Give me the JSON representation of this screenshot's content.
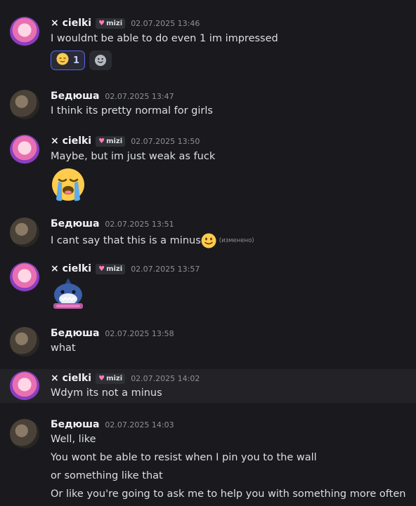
{
  "messages": [
    {
      "author": "× cielki",
      "tag": "mizi",
      "timestamp": "02.07.2025 13:46",
      "lines": [
        "I wouldnt be able to do even 1 im impressed"
      ],
      "reactions": [
        {
          "emoji": "relieved-face",
          "count": "1"
        }
      ]
    },
    {
      "author": "Бедюша",
      "timestamp": "02.07.2025 13:47",
      "lines": [
        "I think its pretty normal for girls"
      ]
    },
    {
      "author": "× cielki",
      "tag": "mizi",
      "timestamp": "02.07.2025 13:50",
      "lines": [
        "Maybe, but im just weak as fuck"
      ],
      "big_emoji": "loudly-crying-face"
    },
    {
      "author": "Бедюша",
      "timestamp": "02.07.2025 13:51",
      "lines": [
        "I cant say that this is a minus"
      ],
      "inline_emoji": "slightly-smiling-face",
      "edited": "(изменено)"
    },
    {
      "author": "× cielki",
      "tag": "mizi",
      "timestamp": "02.07.2025 13:57",
      "sticker": "shark-sticker"
    },
    {
      "author": "Бедюша",
      "timestamp": "02.07.2025 13:58",
      "lines": [
        "what"
      ]
    },
    {
      "author": "× cielki",
      "tag": "mizi",
      "timestamp": "02.07.2025 14:02",
      "lines": [
        "Wdym its not a minus"
      ]
    },
    {
      "author": "Бедюша",
      "timestamp": "02.07.2025 14:03",
      "lines": [
        "Well, like",
        "You wont be able to resist when I pin you to the wall",
        "or something like that",
        "Or like you're going to ask me to help you with something more often"
      ]
    }
  ],
  "colors": {
    "background": "#1a1a1e",
    "hover_row": "#232327",
    "reaction_border": "#5865f2",
    "tag_heart": "#ff7ab8"
  }
}
